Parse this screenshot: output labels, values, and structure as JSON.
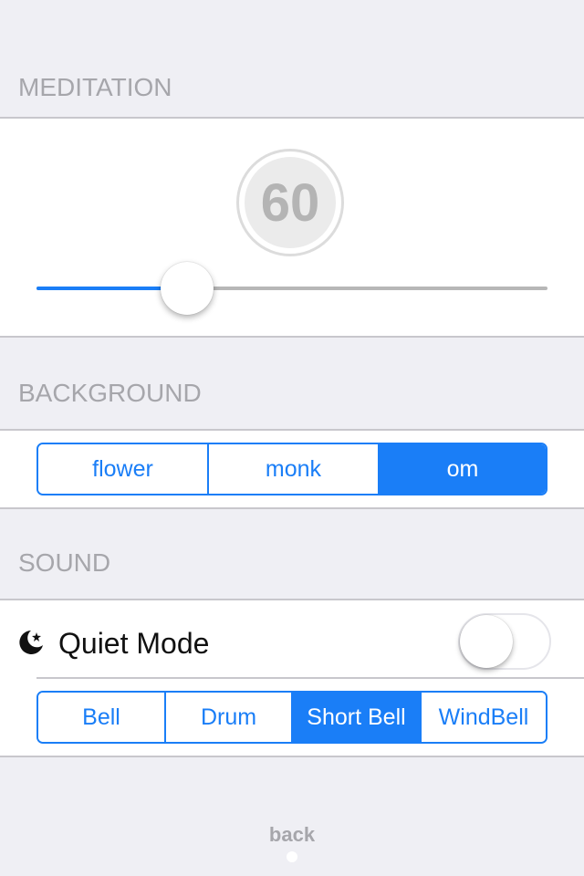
{
  "meditation": {
    "header": "MEDITATION",
    "duration_value": "60",
    "slider_fraction": 0.294
  },
  "background": {
    "header": "BACKGROUND",
    "options": [
      "flower",
      "monk",
      "om"
    ],
    "selected": "om"
  },
  "sound": {
    "header": "SOUND",
    "quiet_mode_label": "Quiet Mode",
    "quiet_mode_on": false,
    "options": [
      "Bell",
      "Drum",
      "Short Bell",
      "WindBell"
    ],
    "selected": "Short Bell"
  },
  "footer": {
    "back_label": "back"
  },
  "colors": {
    "accent": "#1a7ef7",
    "background": "#efeff4",
    "header_text": "#a6a6ab"
  },
  "icons": {
    "quiet_mode": "moon-star-icon"
  }
}
